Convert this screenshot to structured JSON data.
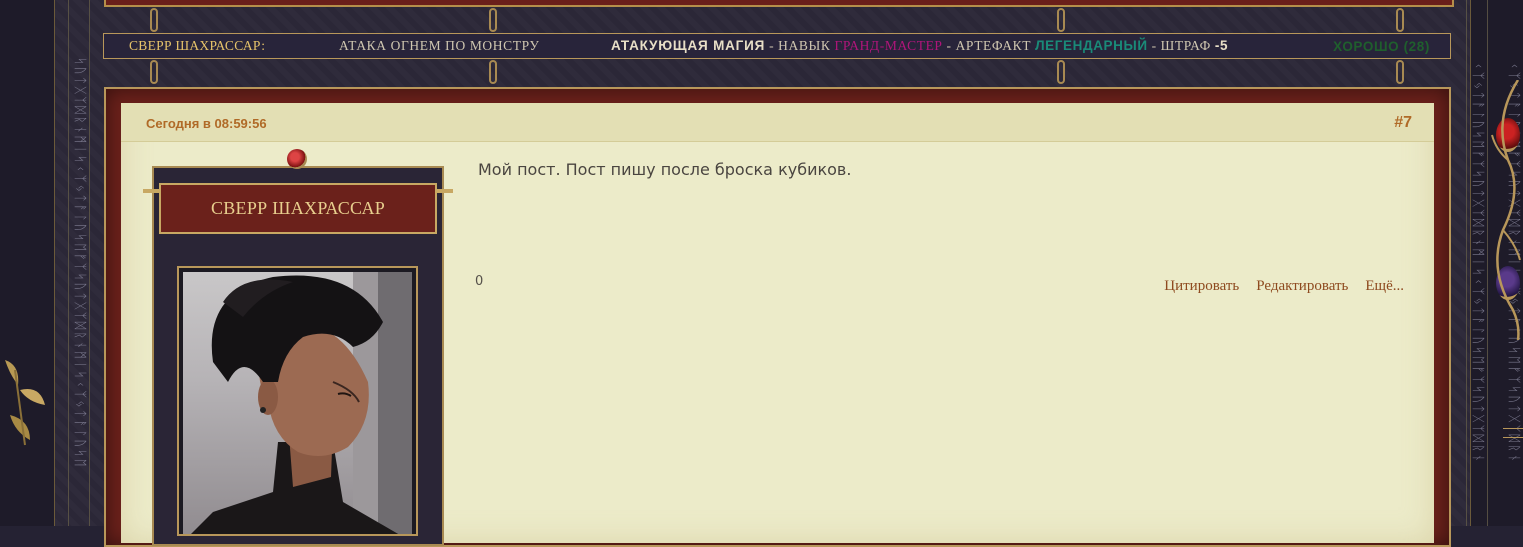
{
  "status_bar": {
    "character": "СВЕРР ШАХРАССАР:",
    "action": "АТАКА ОГНЕМ ПО МОНСТРУ",
    "skill_name": "АТАКУЮЩАЯ МАГИЯ",
    "skill_label": " - НАВЫК ",
    "skill_rank": "ГРАНД-МАСТЕР",
    "artifact_label": " - АРТЕФАКТ ",
    "artifact_rarity": "ЛЕГЕНДАРНЫЙ",
    "penalty_label": " - ШТРАФ ",
    "penalty_value": "-5",
    "result": "ХОРОШО (28)",
    "colors": {
      "rank": "#b0157a",
      "rarity": "#1a8a78",
      "result": "#1f5f2d"
    }
  },
  "post": {
    "timestamp": "Сегодня в 08:59:56",
    "number": "#7",
    "text": "Мой пост. Пост пишу после броска кубиков.",
    "rating": "0",
    "actions": {
      "quote": "Цитировать",
      "edit": "Редактировать",
      "more": "Ещё..."
    }
  },
  "profile": {
    "name": "СВЕРР ШАХРАССАР",
    "avatar_icon": "character-portrait"
  },
  "decor": {
    "runes_left": "ᛋᚢᛏᚷᛉᛞᚱᚾᛗᛁᛋᚲᛉᛃᛏᚨᛚᚢᛋᛖᚠᛉᛋᚢᛏᚷᛉᛞᚱᚾᛗᛁᛋᚲᛉᛃᛏᚨᛚᚢᛋᛖ",
    "runes_right": "ᚲᛉᛃᛏᚨᛚᚢᛋᛖᚠᛉᛋᚢᛏᚷᛉᛞᚱᚾᛗᛁᛋᚲᛉᛃᛏᚨᛚᚢᛋᛖᚠᛉᛋᚢᛏᚷᛉᛞᚱᚾ"
  }
}
